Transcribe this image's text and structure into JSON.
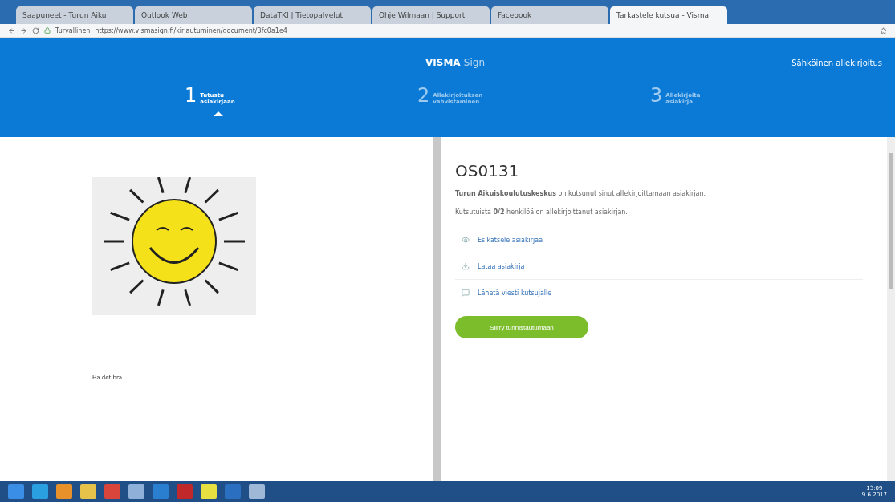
{
  "browser": {
    "tabs": [
      {
        "label": "Saapuneet - Turun Aiku",
        "selected": false
      },
      {
        "label": "Outlook Web",
        "selected": false
      },
      {
        "label": "DataTKI | Tietopalvelut",
        "selected": false
      },
      {
        "label": "Ohje Wilmaan | Supporti",
        "selected": false
      },
      {
        "label": "Facebook",
        "selected": false
      },
      {
        "label": "Tarkastele kutsua - Visma",
        "selected": true
      }
    ],
    "secure_label": "Turvallinen",
    "url": "https://www.vismasign.fi/kirjautuminen/document/3fc0a1e4"
  },
  "header": {
    "logo_bold": "VISMA",
    "logo_light": "Sign",
    "right_label": "Sähköinen allekirjoitus"
  },
  "steps": [
    {
      "number": "1",
      "label": "Tutustu asiakirjaan",
      "selected": true
    },
    {
      "number": "2",
      "label": "Allekirjoituksen vahvistaminen",
      "selected": false
    },
    {
      "number": "3",
      "label": "Allekirjoita asiakirja",
      "selected": false
    }
  ],
  "document": {
    "caption": "Ha det bra"
  },
  "invitation": {
    "title": "OS0131",
    "sentence": "**Turun Aikuiskoulutuskeskus** on kutsunut sinut allekirjoittamaan asiakirjan.",
    "status": "Kutsutuista **0/2** henkilöä on allekirjoittanut asiakirjan.",
    "actions": [
      {
        "kind": "preview",
        "label": "Esikatsele asiakirjaa"
      },
      {
        "kind": "download",
        "label": "Lataa asiakirja"
      },
      {
        "kind": "message",
        "label": "Lähetä viesti kutsujalle"
      }
    ],
    "button": "Siirry tunnistautumaan"
  },
  "taskbar": {
    "time": "13:09",
    "date": "9.6.2017"
  }
}
